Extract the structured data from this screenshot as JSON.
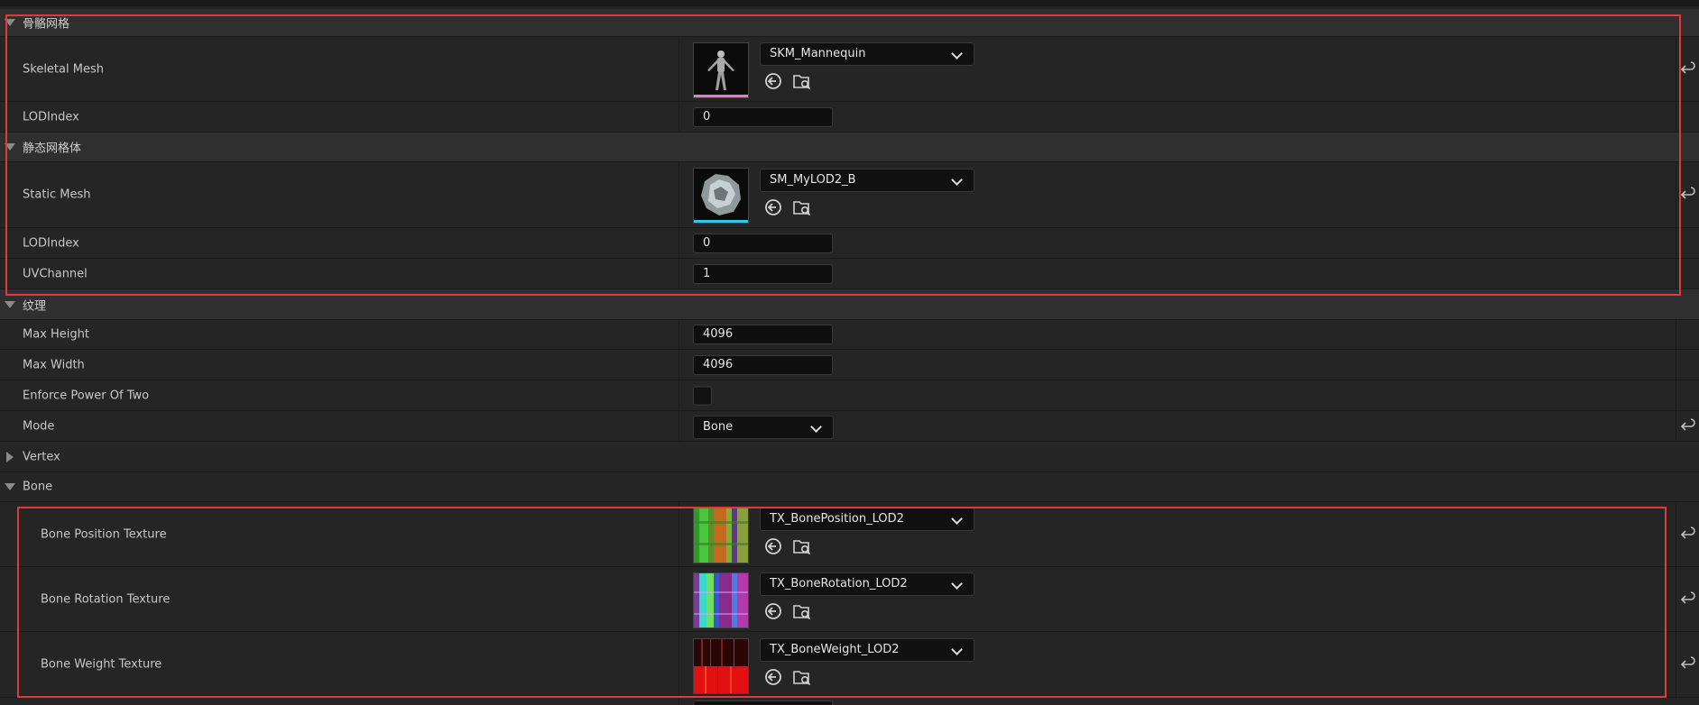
{
  "sections": {
    "skeletal": "骨骼网格",
    "static": "静态网格体",
    "texture": "纹理",
    "vertex": "Vertex",
    "bone": "Bone"
  },
  "props": {
    "skeletal_mesh": {
      "label": "Skeletal Mesh",
      "asset": "SKM_Mannequin"
    },
    "sk_lod": {
      "label": "LODIndex",
      "value": "0"
    },
    "static_mesh": {
      "label": "Static Mesh",
      "asset": "SM_MyLOD2_B"
    },
    "sm_lod": {
      "label": "LODIndex",
      "value": "0"
    },
    "uv_channel": {
      "label": "UVChannel",
      "value": "1"
    },
    "max_height": {
      "label": "Max Height",
      "value": "4096"
    },
    "max_width": {
      "label": "Max Width",
      "value": "4096"
    },
    "enforce_pow2": {
      "label": "Enforce Power Of Two",
      "checked": false
    },
    "mode": {
      "label": "Mode",
      "value": "Bone"
    },
    "bone_position": {
      "label": "Bone Position Texture",
      "asset": "TX_BonePosition_LOD2"
    },
    "bone_rotation": {
      "label": "Bone Rotation Texture",
      "asset": "TX_BoneRotation_LOD2"
    },
    "bone_weight": {
      "label": "Bone Weight Texture",
      "asset": "TX_BoneWeight_LOD2"
    }
  },
  "colors": {
    "highlight": "#e0393e",
    "skeletal_bar": "#e27ad1",
    "static_bar": "#35c6e6"
  },
  "icons": {
    "use_selected": "arrow-left-circle-icon",
    "browse": "folder-search-icon",
    "reset": "reset-arrow-icon"
  }
}
